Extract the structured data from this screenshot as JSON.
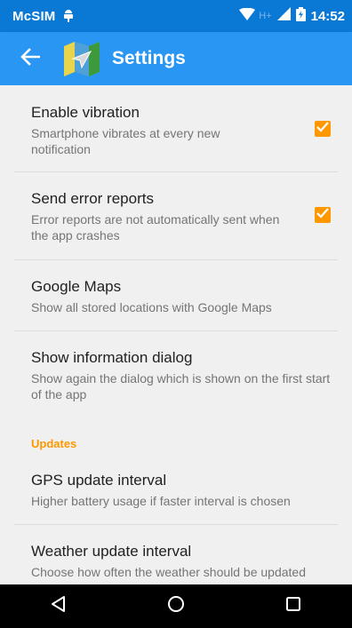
{
  "status_bar": {
    "carrier": "McSIM",
    "network_type": "H+",
    "time": "14:52"
  },
  "app_bar": {
    "title": "Settings",
    "back_icon": "arrow-back-icon",
    "logo_icon": "map-app-logo"
  },
  "preferences": [
    {
      "title": "Enable vibration",
      "summary": "Smartphone vibrates at every new notification",
      "checked": true
    },
    {
      "title": "Send error reports",
      "summary": "Error reports are not automatically sent when the app crashes",
      "checked": true
    },
    {
      "title": "Google Maps",
      "summary": "Show all stored locations with Google Maps"
    },
    {
      "title": "Show information dialog",
      "summary": "Show again the dialog which is shown on the first start of the app"
    }
  ],
  "updates": {
    "category_title": "Updates",
    "items": [
      {
        "title": "GPS update interval",
        "summary": "Higher battery usage if faster interval is chosen"
      },
      {
        "title": "Weather update interval",
        "summary": "Choose how often the weather should be updated"
      }
    ]
  },
  "nav_bar": {
    "back": "triangle-back-icon",
    "home": "circle-home-icon",
    "recents": "square-recents-icon"
  },
  "colors": {
    "status_bar": "#0a79d6",
    "app_bar": "#2a96f3",
    "accent": "#ff9800",
    "background": "#f0f0f0"
  }
}
